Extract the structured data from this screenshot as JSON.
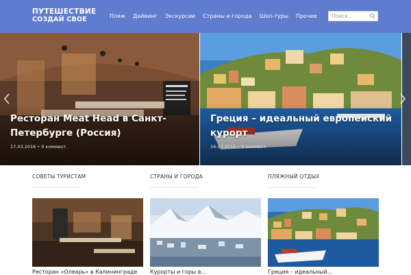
{
  "header": {
    "logo_line1": "ПУТЕШЕСТВИЕ",
    "logo_line2": "СОЗДАЙ СВОЕ",
    "nav": [
      "Пляж",
      "Дайвинг",
      "Экскурсии",
      "Страны и города",
      "Шоп-туры",
      "Прочее"
    ],
    "search_placeholder": "Поиск...",
    "search_icon": "search-icon"
  },
  "slider": {
    "slides": [
      {
        "title": "Ресторан Meat Head в Санкт-Петербурге (Россия)",
        "date": "17.03.2016",
        "comments": "0 коммент."
      },
      {
        "title": "Греция – идеальный европейский курорт",
        "date": "16.03.2016",
        "comments": "0 коммент."
      }
    ],
    "prev_icon": "chevron-left-icon",
    "next_icon": "chevron-right-icon"
  },
  "sections": [
    {
      "title": "СОВЕТЫ ТУРИСТАМ",
      "caption": "Ресторан «Олеарь» в Калининграде"
    },
    {
      "title": "СТРАНЫ И ГОРОДА",
      "caption": "Курорты и горы в..."
    },
    {
      "title": "ПЛЯЖНЫЙ ОТДЫХ",
      "caption": "Греция – идеальный..."
    }
  ],
  "colors": {
    "header": "#5f7ccf",
    "white": "#ffffff"
  }
}
